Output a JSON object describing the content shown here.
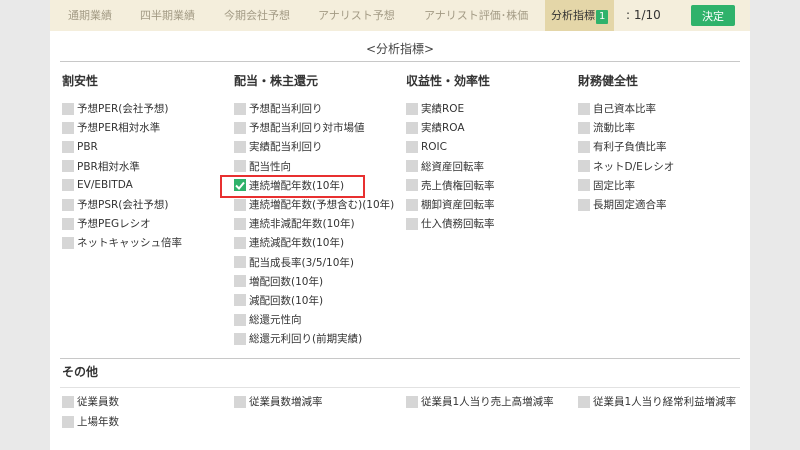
{
  "tabs": [
    {
      "label": "通期業績"
    },
    {
      "label": "四半期業績"
    },
    {
      "label": "今期会社予想"
    },
    {
      "label": "アナリスト予想"
    },
    {
      "label": "アナリスト評価･株価"
    },
    {
      "label": "分析指標",
      "badge": "1"
    }
  ],
  "pager": ": 1/10",
  "decide_label": "決定",
  "section_title": "<分析指標>",
  "columns": [
    {
      "heading": "割安性",
      "items": [
        "予想PER(会社予想)",
        "予想PER相対水準",
        "PBR",
        "PBR相対水準",
        "EV/EBITDA",
        "予想PSR(会社予想)",
        "予想PEGレシオ",
        "ネットキャッシュ倍率"
      ]
    },
    {
      "heading": "配当・株主還元",
      "items": [
        "予想配当利回り",
        "予想配当利回り対市場値",
        "実績配当利回り",
        "配当性向",
        "連続増配年数(10年)",
        "連続増配年数(予想含む)(10年)",
        "連続非減配年数(10年)",
        "連続減配年数(10年)",
        "配当成長率(3/5/10年)",
        "増配回数(10年)",
        "減配回数(10年)",
        "総還元性向",
        "総還元利回り(前期実績)"
      ],
      "checked_index": 4
    },
    {
      "heading": "収益性・効率性",
      "items": [
        "実績ROE",
        "実績ROA",
        "ROIC",
        "総資産回転率",
        "売上債権回転率",
        "棚卸資産回転率",
        "仕入債務回転率"
      ]
    },
    {
      "heading": "財務健全性",
      "items": [
        "自己資本比率",
        "流動比率",
        "有利子負債比率",
        "ネットD/Eレシオ",
        "固定比率",
        "長期固定適合率"
      ]
    }
  ],
  "other": {
    "heading": "その他",
    "items": [
      "従業員数",
      "従業員数増減率",
      "従業員1人当り売上高増減率",
      "従業員1人当り経常利益増減率",
      "上場年数"
    ]
  },
  "colors": {
    "accent": "#2fb26b",
    "tab_bg": "#f4eedc",
    "tab_active": "#e4d6a8",
    "highlight": "#e83030"
  },
  "icons": {
    "check": "checkmark-icon"
  }
}
